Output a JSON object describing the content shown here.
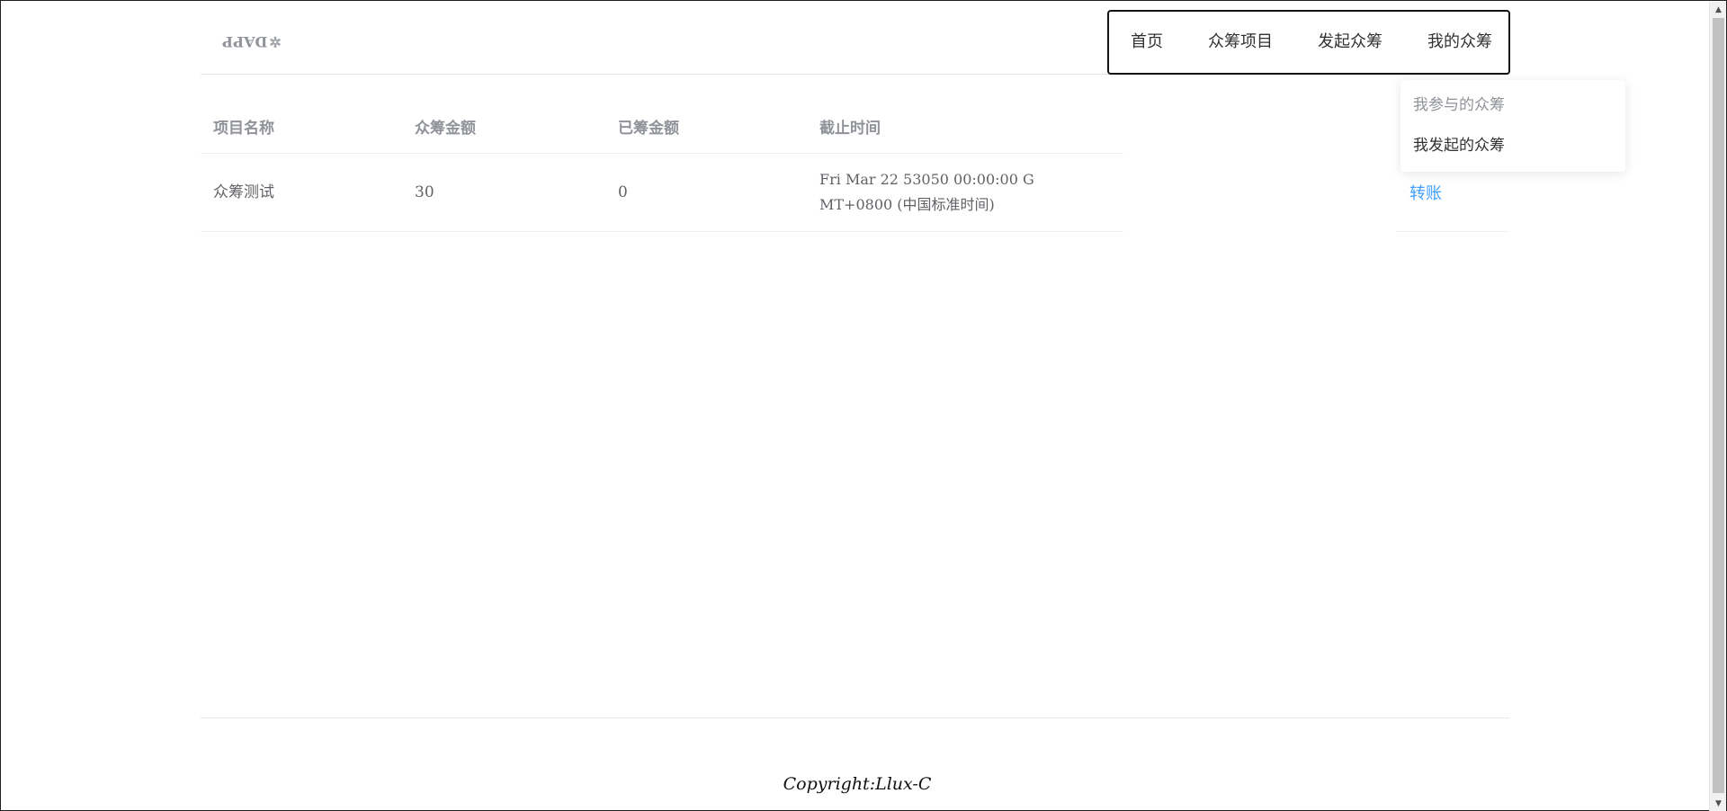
{
  "header": {
    "logo_text": "DAPP",
    "logo_icon": "sparkle-icon",
    "nav": {
      "home": "首页",
      "projects": "众筹项目",
      "launch": "发起众筹",
      "mine": "我的众筹"
    }
  },
  "dropdown": {
    "participated": "我参与的众筹",
    "launched": "我发起的众筹"
  },
  "table": {
    "headers": {
      "name": "项目名称",
      "goal": "众筹金额",
      "raised": "已筹金额",
      "deadline": "截止时间"
    },
    "rows": [
      {
        "name": "众筹测试",
        "goal": "30",
        "raised": "0",
        "deadline_line1": "Fri Mar 22 53050 00:00:00 G",
        "deadline_line2": "MT+0800 (中国标准时间)",
        "action": "转账"
      }
    ]
  },
  "footer": {
    "copyright": "Copyright:Llux-C"
  },
  "colors": {
    "link": "#409eff",
    "header_text": "#909399",
    "body_text": "#606266"
  }
}
